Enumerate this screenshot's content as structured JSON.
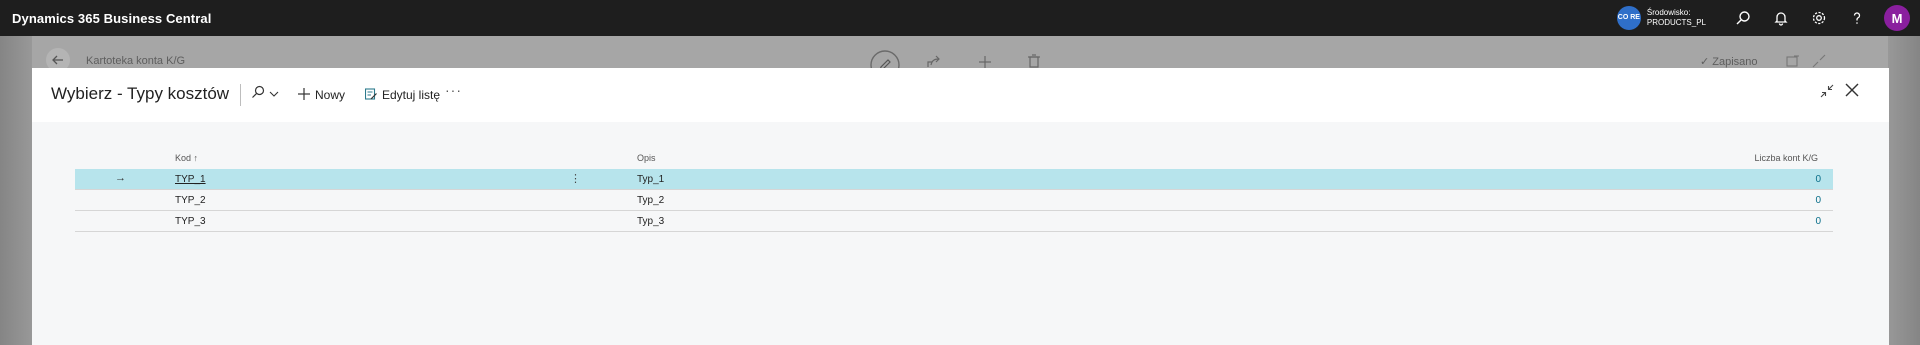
{
  "app": {
    "title": "Dynamics 365 Business Central",
    "environment_badge": "CO RE",
    "environment_label": "Środowisko:",
    "environment_name": "PRODUCTS_PL",
    "avatar_initial": "M"
  },
  "background_page": {
    "title": "Kartoteka konta K/G",
    "saved_label": "Zapisano"
  },
  "dialog": {
    "title": "Wybierz - Typy kosztów",
    "new_label": "Nowy",
    "edit_list_label": "Edytuj listę",
    "more_label": "···"
  },
  "table": {
    "columns": {
      "kod": "Kod ↑",
      "opis": "Opis",
      "count": "Liczba kont K/G"
    },
    "rows": [
      {
        "kod": "TYP_1",
        "opis": "Typ_1",
        "count": "0",
        "selected": true
      },
      {
        "kod": "TYP_2",
        "opis": "Typ_2",
        "count": "0",
        "selected": false
      },
      {
        "kod": "TYP_3",
        "opis": "Typ_3",
        "count": "0",
        "selected": false
      }
    ]
  },
  "colors": {
    "appbar": "#1e1e1e",
    "selected_row": "#b7e4ec",
    "link": "#0a6f8a",
    "avatar": "#8a1f9e",
    "env_badge": "#2f6fc9"
  }
}
